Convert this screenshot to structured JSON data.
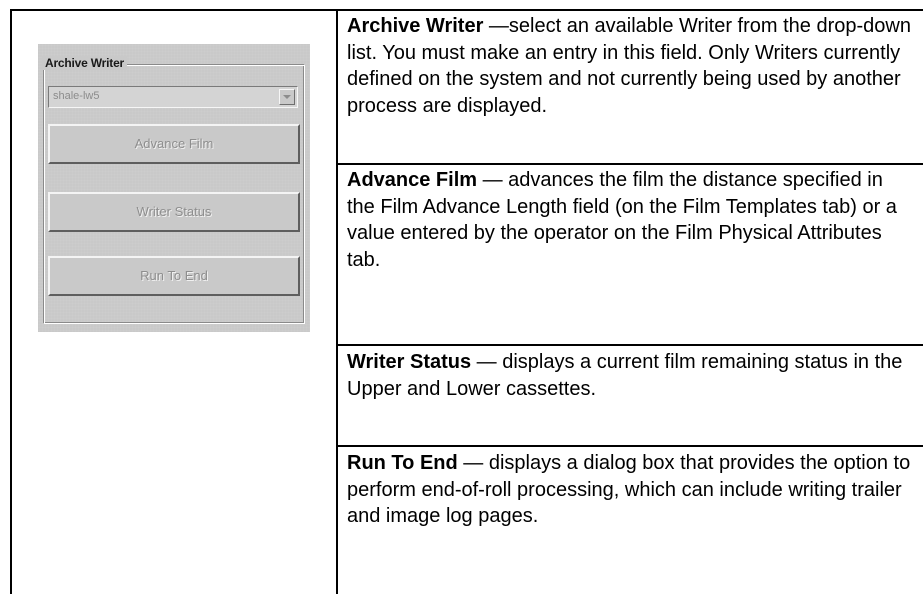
{
  "panel": {
    "group_label": "Archive Writer",
    "combo_value": "shale-lw5",
    "buttons": {
      "advance_film": "Advance Film",
      "writer_status": "Writer Status",
      "run_to_end": "Run To End"
    }
  },
  "rows": [
    {
      "term": "Archive Writer",
      "description": " —select an available Writer from the drop-down list. You must make an entry in this field. Only Writers currently defined on the system and not currently being used by another process are displayed."
    },
    {
      "term": "Advance Film",
      "description": " — advances the film the distance specified in the Film Advance Length field (on the Film Templates tab) or a value entered by the operator on the Film Physical Attributes tab."
    },
    {
      "term": "Writer Status",
      "description": " — displays a current film remaining status in the Upper and Lower cassettes."
    },
    {
      "term": "Run To End",
      "description": " — displays a dialog box that provides the option to perform end-of-roll processing, which can include writing trailer and image log pages."
    }
  ]
}
